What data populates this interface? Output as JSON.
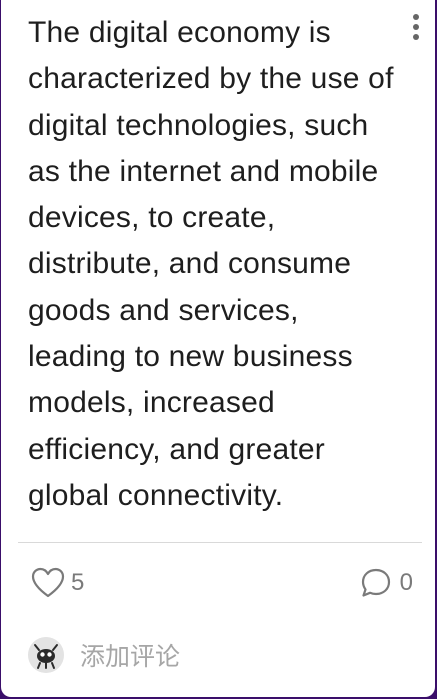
{
  "post": {
    "text": "The digital economy is characterized by the use of digital technologies, such as the internet and mobile devices, to create, distribute, and consume goods and services, leading to new business models, increased efficiency, and greater global connectivity."
  },
  "actions": {
    "like_count": "5",
    "comment_count": "0"
  },
  "comment_box": {
    "placeholder": "添加评论"
  },
  "icons": {
    "more": "more-vertical-icon",
    "like": "heart-icon",
    "comment": "comment-bubble-icon",
    "avatar": "user-avatar-icon"
  },
  "colors": {
    "background": "#3a0e6a",
    "card": "#ffffff",
    "muted": "#7a7a7a"
  }
}
